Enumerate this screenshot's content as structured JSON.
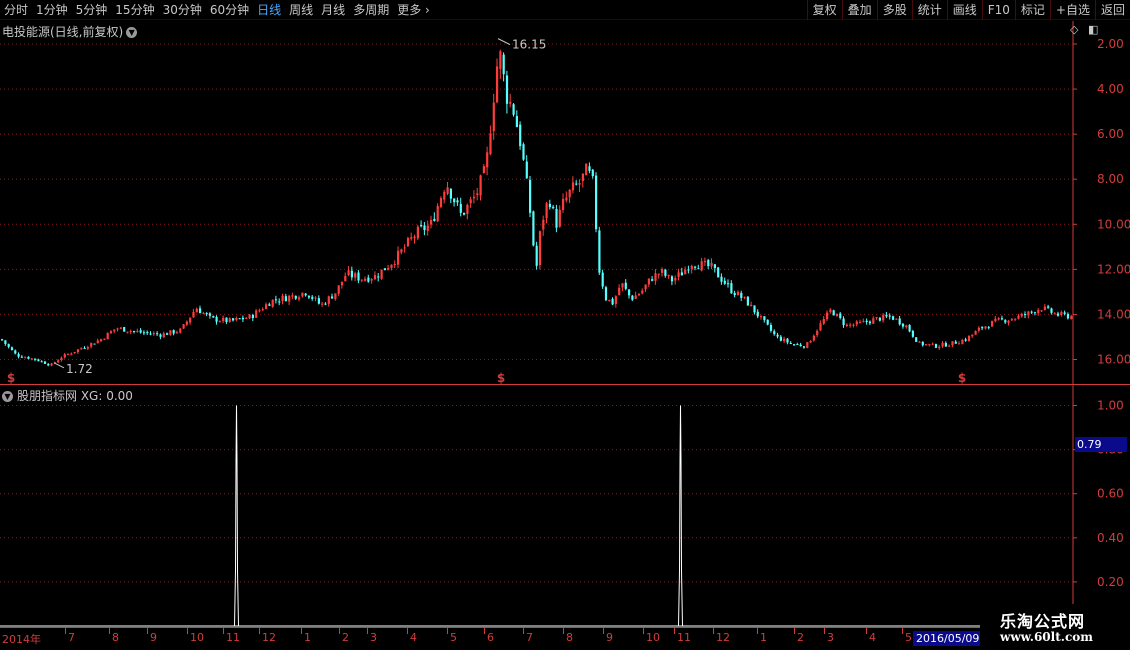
{
  "toolbar": {
    "periods": [
      "分时",
      "1分钟",
      "5分钟",
      "15分钟",
      "30分钟",
      "60分钟",
      "日线",
      "周线",
      "月线",
      "多周期"
    ],
    "active_period": "日线",
    "more_label": "更多",
    "tools": [
      "复权",
      "叠加",
      "多股",
      "统计",
      "画线",
      "F10",
      "标记",
      "+自选",
      "返回"
    ]
  },
  "main_chart": {
    "title": "电投能源(日线,前复权)",
    "y_ticks": [
      "16.00",
      "14.00",
      "12.00",
      "10.00",
      "8.00",
      "6.00",
      "4.00",
      "2.00"
    ],
    "high_label": "16.15",
    "low_label": "1.72",
    "signal_marker": "$"
  },
  "indicator": {
    "title": "股朋指标网 XG: 0.00",
    "y_ticks": [
      "1.00",
      "0.80",
      "0.60",
      "0.40",
      "0.20"
    ],
    "current_value": "0.79"
  },
  "date_axis": {
    "ticks": [
      "2014年",
      "7",
      "8",
      "9",
      "10",
      "11",
      "12",
      "1",
      "2",
      "3",
      "4",
      "5",
      "6",
      "7",
      "8",
      "9",
      "10",
      "11",
      "12",
      "1",
      "2",
      "3",
      "4",
      "5"
    ],
    "current_date": "2016/05/09"
  },
  "watermark": {
    "title": "乐淘公式网",
    "url": "www.60lt.com"
  },
  "colors": {
    "up": "#ff3c3c",
    "down": "#54ffff",
    "grid": "#8a1a1a",
    "axis": "#d23c3c",
    "active_tab": "#4aa8ff"
  },
  "chart_data": [
    {
      "type": "candlestick",
      "title": "电投能源(日线,前复权)",
      "ylim": [
        1.5,
        16.5
      ],
      "y_ticks": [
        2,
        4,
        6,
        8,
        10,
        12,
        14,
        16
      ],
      "anchors": [
        [
          0,
          2.9
        ],
        [
          15,
          2.2
        ],
        [
          35,
          2.0
        ],
        [
          50,
          1.75
        ],
        [
          60,
          2.1
        ],
        [
          80,
          2.5
        ],
        [
          100,
          2.9
        ],
        [
          115,
          3.4
        ],
        [
          140,
          3.2
        ],
        [
          160,
          3.1
        ],
        [
          180,
          3.3
        ],
        [
          195,
          4.3
        ],
        [
          210,
          3.8
        ],
        [
          230,
          3.7
        ],
        [
          250,
          3.9
        ],
        [
          270,
          4.6
        ],
        [
          290,
          4.8
        ],
        [
          305,
          5.0
        ],
        [
          320,
          4.4
        ],
        [
          335,
          5.0
        ],
        [
          345,
          5.8
        ],
        [
          360,
          5.6
        ],
        [
          375,
          5.7
        ],
        [
          395,
          6.5
        ],
        [
          415,
          7.6
        ],
        [
          430,
          8.0
        ],
        [
          445,
          9.9
        ],
        [
          460,
          8.4
        ],
        [
          475,
          9.3
        ],
        [
          485,
          10.5
        ],
        [
          492,
          13.5
        ],
        [
          498,
          15.8
        ],
        [
          505,
          13.8
        ],
        [
          513,
          13.0
        ],
        [
          520,
          11.5
        ],
        [
          528,
          9.0
        ],
        [
          535,
          5.9
        ],
        [
          540,
          8.0
        ],
        [
          548,
          9.2
        ],
        [
          555,
          8.0
        ],
        [
          562,
          8.9
        ],
        [
          570,
          9.5
        ],
        [
          578,
          9.8
        ],
        [
          586,
          10.4
        ],
        [
          592,
          9.8
        ],
        [
          598,
          6.0
        ],
        [
          605,
          4.7
        ],
        [
          612,
          4.5
        ],
        [
          620,
          5.4
        ],
        [
          630,
          4.7
        ],
        [
          640,
          5.0
        ],
        [
          650,
          5.6
        ],
        [
          660,
          5.9
        ],
        [
          670,
          5.5
        ],
        [
          680,
          5.8
        ],
        [
          690,
          6.3
        ],
        [
          700,
          6.2
        ],
        [
          710,
          6.1
        ],
        [
          720,
          5.6
        ],
        [
          730,
          5.1
        ],
        [
          745,
          4.6
        ],
        [
          760,
          3.8
        ],
        [
          775,
          3.0
        ],
        [
          790,
          2.7
        ],
        [
          805,
          2.6
        ],
        [
          820,
          3.6
        ],
        [
          830,
          4.2
        ],
        [
          845,
          3.5
        ],
        [
          860,
          3.6
        ],
        [
          875,
          3.8
        ],
        [
          890,
          3.9
        ],
        [
          905,
          3.5
        ],
        [
          918,
          2.7
        ],
        [
          935,
          2.6
        ],
        [
          950,
          2.7
        ],
        [
          965,
          2.9
        ],
        [
          980,
          3.4
        ],
        [
          995,
          3.7
        ],
        [
          1010,
          3.8
        ],
        [
          1025,
          4.0
        ],
        [
          1040,
          4.3
        ],
        [
          1055,
          4.0
        ],
        [
          1072,
          3.9
        ]
      ],
      "annotations": [
        {
          "label": "16.15",
          "value": 16.15
        },
        {
          "label": "1.72",
          "value": 1.72
        }
      ]
    },
    {
      "type": "line",
      "title": "股朋指标网 XG: 0.00",
      "ylim": [
        0,
        1.0
      ],
      "y_ticks": [
        0.2,
        0.4,
        0.6,
        0.8,
        1.0
      ],
      "spikes": [
        {
          "value": 1.0
        },
        {
          "value": 1.0
        }
      ]
    }
  ]
}
